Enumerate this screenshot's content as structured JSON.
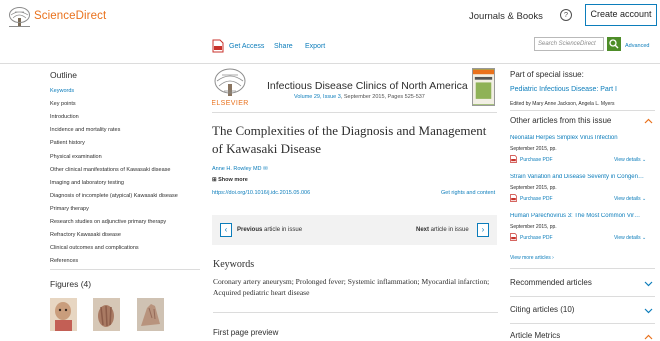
{
  "header": {
    "brand": "ScienceDirect",
    "journals_books": "Journals & Books",
    "help": "?",
    "create_account": "Create account"
  },
  "toolbar": {
    "get_access": "Get Access",
    "share": "Share",
    "export": "Export",
    "search_placeholder": "Search ScienceDirect",
    "advanced": "Advanced"
  },
  "outline": {
    "title": "Outline",
    "items": [
      "Keywords",
      "Key points",
      "Introduction",
      "Incidence and mortality rates",
      "Patient history",
      "Physical examination",
      "Other clinical manifestations of Kawasaki disease",
      "Imaging and laboratory testing",
      "Diagnosis of incomplete (atypical) Kawasaki disease",
      "Primary therapy",
      "Research studies on adjunctive primary therapy",
      "Refractory Kawasaki disease",
      "Clinical outcomes and complications",
      "References"
    ],
    "figures_title": "Figures (4)"
  },
  "article": {
    "journal": "Infectious Disease Clinics of North America",
    "volume_link": "Volume 29, Issue 3",
    "volume_rest": ", September 2015, Pages 525-537",
    "title": "The Complexities of the Diagnosis and Management of Kawasaki Disease",
    "author": "Anne H. Rowley MD",
    "show_more": "Show more",
    "doi": "https://doi.org/10.1016/j.idc.2015.05.006",
    "rights": "Get rights and content",
    "previous_bold": "Previous",
    "previous_rest": " article in issue",
    "next_bold": "Next",
    "next_rest": " article in issue",
    "keywords_title": "Keywords",
    "keywords": "Coronary artery aneurysm; Prolonged fever; Systemic inflammation; Myocardial infarction; Acquired pediatric heart disease",
    "first_page_preview": "First page preview"
  },
  "sidebar": {
    "part_of": "Part of special issue:",
    "issue_title": "Pediatric Infectious Disease: Part I",
    "editors": "Edited by Mary Anne Jackson, Angela L. Myers",
    "other_articles": "Other articles from this issue",
    "related": [
      {
        "title": "Neonatal Herpes Simplex Virus Infection",
        "date": "September 2015, pp.",
        "pdf": "Purchase PDF",
        "details": "View details"
      },
      {
        "title": "Strain Variation and Disease Severity in Congen…",
        "date": "September 2015, pp.",
        "pdf": "Purchase PDF",
        "details": "View details"
      },
      {
        "title": "Human Parechovirus 3: The Most Common Vir…",
        "date": "September 2015, pp.",
        "pdf": "Purchase PDF",
        "details": "View details"
      }
    ],
    "view_more": "View more articles",
    "recommended": "Recommended articles",
    "citing": "Citing articles (10)",
    "metrics": "Article Metrics"
  },
  "colors": {
    "brand_orange": "#e9711c",
    "link_blue": "#0c7dbb",
    "search_green": "#4e8d29"
  }
}
